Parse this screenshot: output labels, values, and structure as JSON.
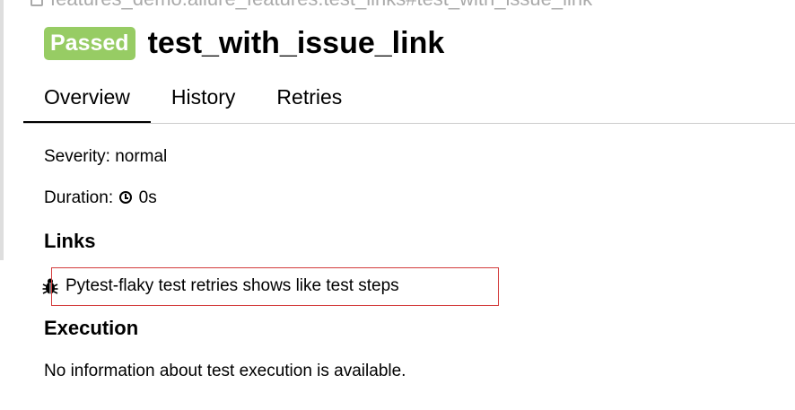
{
  "breadcrumb": {
    "text": "features_demo.allure_features.test_links#test_with_issue_link"
  },
  "header": {
    "status": "Passed",
    "title": "test_with_issue_link",
    "status_color": "#97cc64"
  },
  "tabs": [
    {
      "label": "Overview",
      "active": true
    },
    {
      "label": "History",
      "active": false
    },
    {
      "label": "Retries",
      "active": false
    }
  ],
  "overview": {
    "severity_label": "Severity:",
    "severity_value": "normal",
    "duration_label": "Duration:",
    "duration_value": "0s",
    "links_heading": "Links",
    "issue_link_text": "Pytest-flaky test retries shows like test steps",
    "execution_heading": "Execution",
    "execution_message": "No information about test execution is available."
  },
  "icons": {
    "breadcrumb": "copy-icon",
    "duration": "clock-icon",
    "issue": "bug-icon"
  },
  "annotation": {
    "highlight_color": "#d33b3b"
  }
}
